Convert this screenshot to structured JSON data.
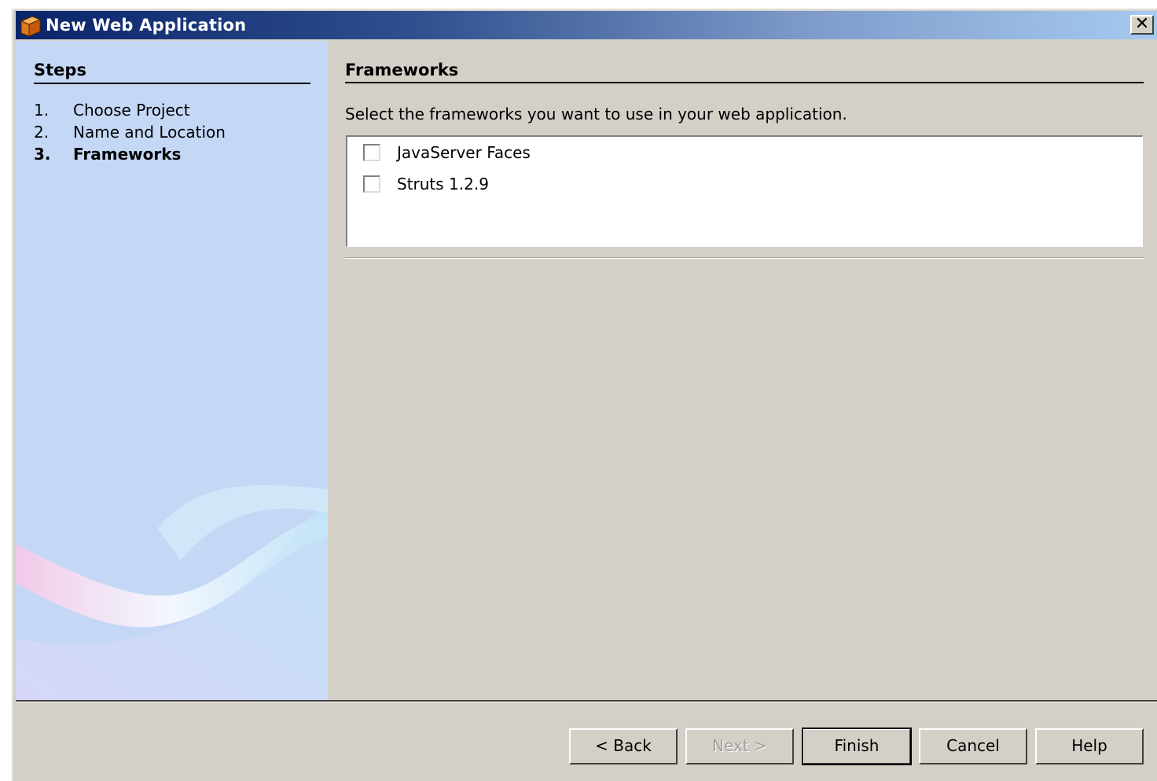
{
  "window": {
    "title": "New Web Application",
    "close_label": "✕"
  },
  "steps": {
    "heading": "Steps",
    "items": [
      {
        "num": "1.",
        "label": "Choose Project",
        "current": false
      },
      {
        "num": "2.",
        "label": "Name and Location",
        "current": false
      },
      {
        "num": "3.",
        "label": "Frameworks",
        "current": true
      }
    ]
  },
  "main": {
    "heading": "Frameworks",
    "instruction": "Select the frameworks you want to use in your web application.",
    "frameworks": [
      {
        "label": "JavaServer Faces",
        "checked": false
      },
      {
        "label": "Struts 1.2.9",
        "checked": false
      }
    ]
  },
  "buttons": {
    "back": "< Back",
    "next": "Next >",
    "finish": "Finish",
    "cancel": "Cancel",
    "help": "Help"
  },
  "colors": {
    "titlebar_start": "#0a246a",
    "titlebar_end": "#a6caf0",
    "dialog_bg": "#d4d0c8",
    "steps_panel_bg": "#c4d8f6"
  },
  "icons": {
    "title": "netbeans-app-icon",
    "close": "close-icon"
  }
}
